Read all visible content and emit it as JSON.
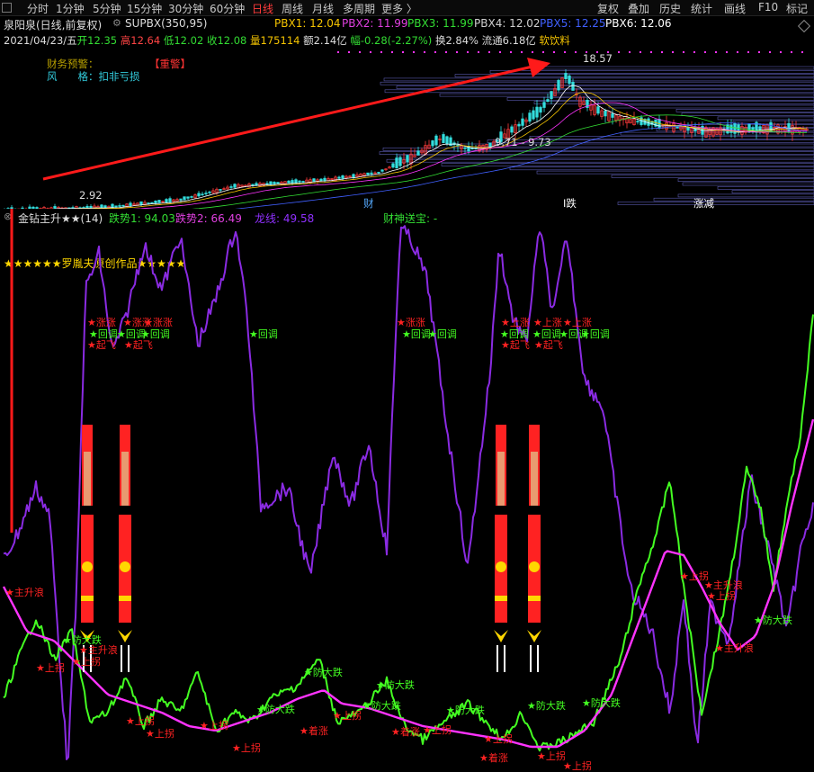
{
  "toolbar": {
    "tabs": [
      "分时",
      "1分钟",
      "5分钟",
      "15分钟",
      "30分钟",
      "60分钟",
      "日线",
      "周线",
      "月线",
      "多周期",
      "更多 〉"
    ],
    "active": "日线",
    "right": [
      "复权",
      "叠加",
      "历史",
      "统计",
      "画线",
      "F10",
      "标记"
    ]
  },
  "stock": {
    "name": "泉阳泉(日线,前复权)",
    "indicator": "SUPBX(350,95)",
    "pbx": [
      {
        "label": "PBX1: 12.04",
        "color": "#f5c400"
      },
      {
        "label": "PBX2: 11.99",
        "color": "#e040e0"
      },
      {
        "label": "PBX3: 11.99",
        "color": "#33dd33"
      },
      {
        "label": "PBX4: 12.02",
        "color": "#d0d0d0"
      },
      {
        "label": "PBX5: 12.25",
        "color": "#4060ff"
      },
      {
        "label": "PBX6: 12.06",
        "color": "#ffffff"
      }
    ],
    "quote": {
      "date": "2021/04/23/五",
      "open_label": "开",
      "open": "12.35",
      "high_label": "高",
      "high": "12.64",
      "low_label": "低",
      "low": "12.02",
      "close_label": "收",
      "close": "12.08",
      "vol_label": "量",
      "vol": "175114",
      "amt": "额2.14亿",
      "chg": "幅-0.28(-2.27%)",
      "turnover": "换2.84%",
      "float": "流通6.18亿",
      "sector": "软饮料"
    },
    "finance_warning": "财务预警：",
    "warning_badge": "【重警】",
    "style_label": "风　　格：扣非亏损",
    "price_high": "18.57",
    "price_low": "2.92",
    "price_mid": "9.71 - 9.73",
    "markers": [
      "财",
      "I跌",
      "涨减"
    ]
  },
  "indicator": {
    "title": "金钻主升★★(14)",
    "values": [
      {
        "label": "跌势1: 94.03",
        "color": "#33dd33"
      },
      {
        "label": "跌势2: 66.49",
        "color": "#e040e0"
      },
      {
        "label": "龙线: 49.58",
        "color": "#9030ff"
      },
      {
        "label": "财神送宝: -",
        "color": "#33dd33"
      }
    ],
    "banner": "★★★★★★罗胤夫原创作品★★★★★"
  },
  "signals": {
    "red": [
      "★涨涨",
      "★上涨",
      "★起飞",
      "★主升浪",
      "★上拐",
      "★着涨"
    ],
    "green": [
      "★回调",
      "★防大跌"
    ]
  },
  "colors": {
    "purple": "#8a2be2",
    "magenta": "#ff33ff",
    "green": "#44ff22",
    "red": "#ff2222",
    "yellow": "#ffd700"
  }
}
